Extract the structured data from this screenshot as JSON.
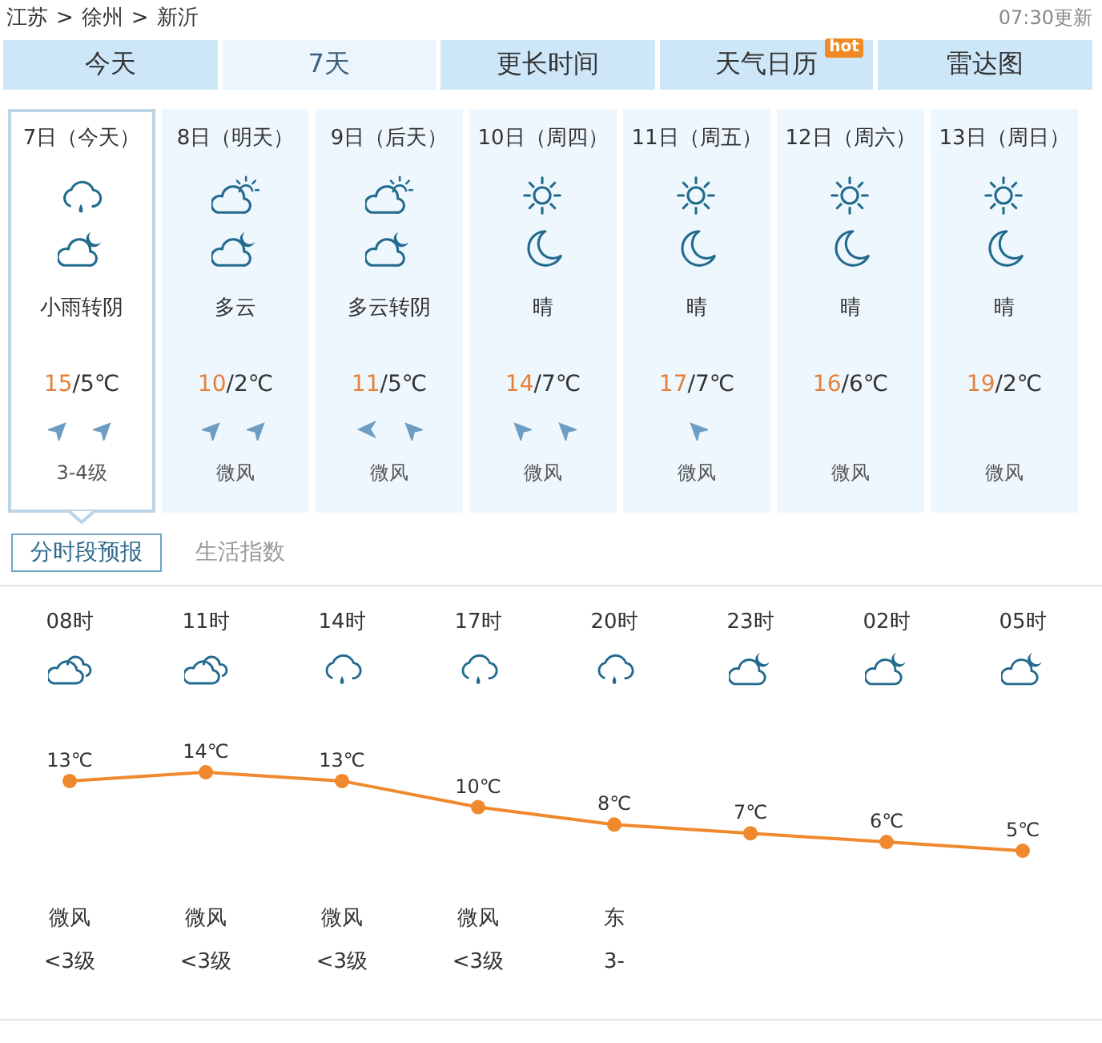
{
  "header": {
    "breadcrumb": [
      {
        "label": "江苏",
        "separator": ">"
      },
      {
        "label": "徐州",
        "separator": ">"
      },
      {
        "label": "新沂"
      }
    ],
    "updated": "07:30更新"
  },
  "tabs": [
    {
      "label": "今天",
      "selected": false
    },
    {
      "label": "7天",
      "selected": true
    },
    {
      "label": "更长时间",
      "selected": false
    },
    {
      "label": "天气日历",
      "selected": false,
      "badge": "hot"
    },
    {
      "label": "雷达图",
      "selected": false
    }
  ],
  "days": [
    {
      "date": "7日（今天）",
      "selected": true,
      "icons": [
        {
          "kind": "rain"
        },
        {
          "kind": "cloudy-night"
        }
      ],
      "weather": "小雨转阴",
      "high": "15",
      "low": "/5℃",
      "wind_arrows": [
        {
          "kind": "northeast"
        },
        {
          "kind": "northeast"
        }
      ],
      "wind": "3-4级"
    },
    {
      "date": "8日（明天）",
      "selected": false,
      "icons": [
        {
          "kind": "cloudy-day"
        },
        {
          "kind": "cloudy-night"
        }
      ],
      "weather": "多云",
      "high": "10",
      "low": "/2℃",
      "wind_arrows": [
        {
          "kind": "northeast"
        },
        {
          "kind": "northeast"
        }
      ],
      "wind": "微风"
    },
    {
      "date": "9日（后天）",
      "selected": false,
      "icons": [
        {
          "kind": "cloudy-day"
        },
        {
          "kind": "cloudy-night"
        }
      ],
      "weather": "多云转阴",
      "high": "11",
      "low": "/5℃",
      "wind_arrows": [
        {
          "kind": "west"
        },
        {
          "kind": "northwest"
        }
      ],
      "wind": "微风"
    },
    {
      "date": "10日（周四）",
      "selected": false,
      "icons": [
        {
          "kind": "sunny"
        },
        {
          "kind": "clear-night"
        }
      ],
      "weather": "晴",
      "high": "14",
      "low": "/7℃",
      "wind_arrows": [
        {
          "kind": "northwest"
        },
        {
          "kind": "northwest"
        }
      ],
      "wind": "微风"
    },
    {
      "date": "11日（周五）",
      "selected": false,
      "icons": [
        {
          "kind": "sunny"
        },
        {
          "kind": "clear-night"
        }
      ],
      "weather": "晴",
      "high": "17",
      "low": "/7℃",
      "wind_arrows": [
        {
          "kind": "northwest"
        }
      ],
      "wind": "微风"
    },
    {
      "date": "12日（周六）",
      "selected": false,
      "icons": [
        {
          "kind": "sunny"
        },
        {
          "kind": "clear-night"
        }
      ],
      "weather": "晴",
      "high": "16",
      "low": "/6℃",
      "wind": "微风"
    },
    {
      "date": "13日（周日）",
      "selected": false,
      "icons": [
        {
          "kind": "sunny"
        },
        {
          "kind": "clear-night"
        }
      ],
      "weather": "晴",
      "high": "19",
      "low": "/2℃",
      "wind": "微风"
    }
  ],
  "hourly": {
    "tabs": [
      {
        "label": "分时段预报",
        "selected": true
      },
      {
        "label": "生活指数",
        "selected": false
      }
    ],
    "columns": [
      {
        "kind": "overcast",
        "wind": "微风",
        "wind_force": "<3级"
      },
      {
        "kind": "overcast",
        "wind": "微风",
        "wind_force": "<3级"
      },
      {
        "kind": "rain",
        "wind": "微风",
        "wind_force": "<3级"
      },
      {
        "kind": "rain",
        "wind": "微风",
        "wind_force": "<3级"
      },
      {
        "kind": "rain",
        "wind": "东",
        "wind_force": "3-"
      },
      {
        "kind": "cloudy-night"
      },
      {
        "kind": "cloudy-night"
      },
      {
        "kind": "cloudy-night"
      }
    ],
    "chart_data": {
      "type": "line",
      "categories": [
        "08时",
        "11时",
        "14时",
        "17时",
        "20时",
        "23时",
        "02时",
        "05时"
      ],
      "values": [
        13,
        14,
        13,
        10,
        8,
        7,
        6,
        5
      ],
      "value_labels": [
        "13℃",
        "14℃",
        "13℃",
        "10℃",
        "8℃",
        "7℃",
        "6℃",
        "5℃"
      ],
      "marker": "circle"
    }
  }
}
